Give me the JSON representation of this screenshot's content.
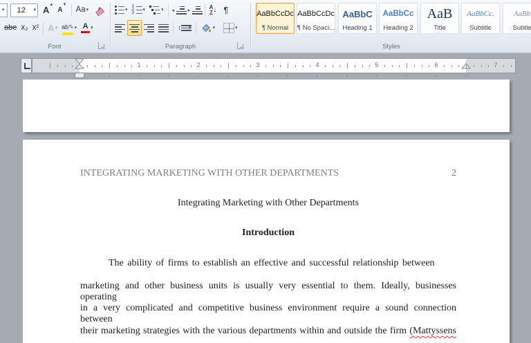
{
  "ribbon": {
    "groups": {
      "font_label": "Font",
      "paragraph_label": "Paragraph",
      "styles_label": "Styles"
    },
    "font": {
      "size_value": "12",
      "grow_font": "A",
      "shrink_font": "A",
      "change_case": "Aa",
      "clear_format": "A",
      "strikethrough": "abe",
      "subscript": "x₂",
      "superscript": "x²",
      "text_effects": "A",
      "highlight": "ab",
      "font_color": "A"
    },
    "paragraph": {
      "pilcrow": "¶",
      "sort_a": "A",
      "sort_z": "Z",
      "sort_arrow": "↓",
      "spacing_arrow": "↕"
    },
    "styles": {
      "items": [
        {
          "preview": "AaBbCcDc",
          "label": "¶ Normal",
          "selected": true
        },
        {
          "preview": "AaBbCcDc",
          "label": "¶ No Spaci...",
          "selected": false
        },
        {
          "preview": "AaBbC",
          "label": "Heading 1",
          "selected": false
        },
        {
          "preview": "AaBbCc",
          "label": "Heading 2",
          "selected": false
        },
        {
          "preview": "AaB",
          "label": "Title",
          "selected": false
        },
        {
          "preview": "AaBbCc.",
          "label": "Subtitle",
          "selected": false
        },
        {
          "preview": "AaBb",
          "label": "Subtle",
          "selected": false
        }
      ]
    },
    "colors": {
      "toggle_highlight": "#fbdd85",
      "selected_border": "#e8a33d",
      "heading1_blue": "#365f91",
      "heading2_blue": "#4f81bd",
      "title_blue": "#17365d",
      "highlight_yellow": "#ffe400",
      "font_color_red": "#e00000"
    }
  },
  "ruler": {
    "numbers": [
      "1",
      "2",
      "3",
      "4",
      "5",
      "6",
      "7"
    ]
  },
  "document": {
    "header": {
      "running_head": "INTEGRATING MARKETING WITH OTHER DEPARTMENTS",
      "page_number": "2"
    },
    "title": "Integrating Marketing with Other Departments",
    "heading": "Introduction",
    "body": {
      "line1": "The ability of firms to establish an effective and successful relationship between",
      "line2": "marketing and other business units is usually very essential to them. Ideally, businesses operating",
      "line3": "in a very complicated and competitive business environment require a sound connection between",
      "line4_prefix": "their marketing strategies with the various departments within and outside the firm ",
      "line4_misspelled": "(Mattyssens"
    }
  }
}
